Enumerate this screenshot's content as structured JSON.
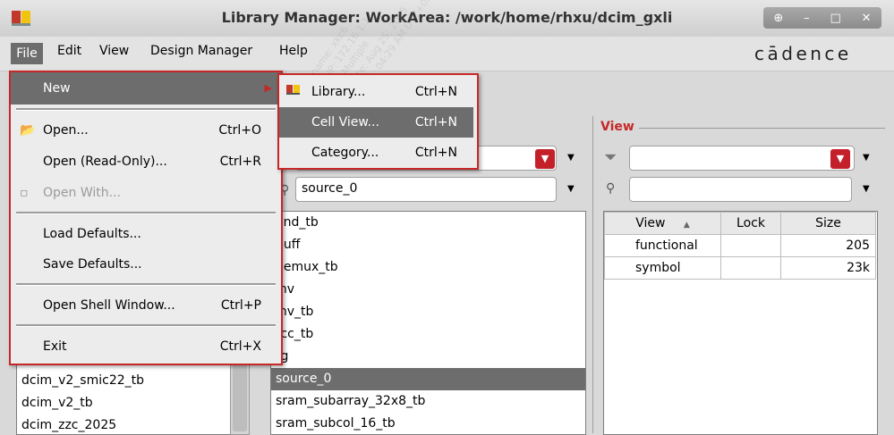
{
  "window": {
    "title": "Library Manager: WorkArea:  /work/home/rhxu/dcim_gxli",
    "wm_buttons": [
      "⊕",
      "–",
      "□",
      "✕"
    ]
  },
  "menubar": {
    "items": [
      {
        "label": "File"
      },
      {
        "label": "Edit"
      },
      {
        "label": "View"
      },
      {
        "label": "Design Manager"
      },
      {
        "label": "Help"
      }
    ],
    "brand": "cādence"
  },
  "file_menu": {
    "items": [
      {
        "label": "New",
        "accel": ""
      },
      {
        "label": "Open...",
        "accel": "Ctrl+O"
      },
      {
        "label": "Open (Read-Only)...",
        "accel": "Ctrl+R"
      },
      {
        "label": "Open With...",
        "accel": ""
      },
      {
        "label": "Load Defaults...",
        "accel": ""
      },
      {
        "label": "Save Defaults...",
        "accel": ""
      },
      {
        "label": "Open Shell Window...",
        "accel": "Ctrl+P"
      },
      {
        "label": "Exit",
        "accel": "Ctrl+X"
      }
    ]
  },
  "new_submenu": {
    "items": [
      {
        "label": "Library...",
        "accel": "Ctrl+N"
      },
      {
        "label": "Cell View...",
        "accel": "Ctrl+N"
      },
      {
        "label": "Category...",
        "accel": "Ctrl+N"
      }
    ]
  },
  "library_list": {
    "items": [
      "dcim_v2_smic22_tb",
      "dcim_v2_tb",
      "dcim_zzc_2025"
    ]
  },
  "cell_panel": {
    "filter_value": "source_0",
    "items": [
      "and_tb",
      "buff",
      "demux_tb",
      "inv",
      "inv_tb",
      "rcc_tb",
      "rg",
      "source_0",
      "sram_subarray_32x8_tb",
      "sram_subcol_16_tb"
    ]
  },
  "view_panel": {
    "title": "View",
    "columns": [
      "View",
      "Lock",
      "Size"
    ],
    "rows": [
      {
        "view": "functional",
        "lock": "",
        "size": "205"
      },
      {
        "view": "symbol",
        "lock": "",
        "size": "23k"
      }
    ]
  },
  "watermark": {
    "lines": [
      "Hostname: xkc6",
      "Client IP: 172.16.1.1",
      "Host IP: Multiple",
      "Server date: Aug 25, 2025",
      "Server time: 04:29 AM UTC+0800"
    ]
  }
}
